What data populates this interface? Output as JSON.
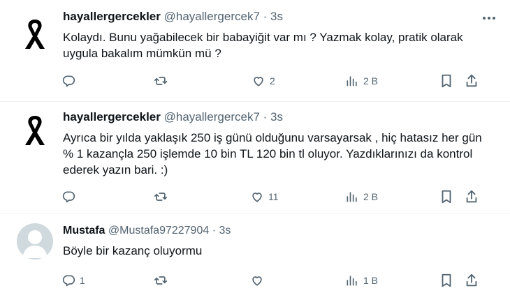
{
  "tweets": [
    {
      "name": "hayallergercekler",
      "handle": "@hayallergercek7",
      "dot": "·",
      "time": "3s",
      "avatar_icon": "black-ribbon-icon",
      "text": "Kolaydı. Bunu yağabilecek bir babayiğit var mı ?  Yazmak kolay, pratik olarak uygula bakalım mümkün mü ?",
      "replies": "",
      "retweets": "",
      "likes": "2",
      "views": "2 B"
    },
    {
      "name": "hayallergercekler",
      "handle": "@hayallergercek7",
      "dot": "·",
      "time": "3s",
      "avatar_icon": "black-ribbon-icon",
      "text": "Ayrıca bir yılda yaklaşık 250 iş günü olduğunu varsayarsak , hiç hatasız her gün % 1 kazançla 250 işlemde 10 bin TL 120 bin tl oluyor. Yazdıklarınızı da kontrol ederek yazın bari. :)",
      "replies": "",
      "retweets": "",
      "likes": "11",
      "views": "2 B"
    },
    {
      "name": "Mustafa",
      "handle": "@Mustafa97227904",
      "dot": "·",
      "time": "3s",
      "avatar_icon": "default-avatar-icon",
      "text": "Böyle bir kazanç oluyormu",
      "replies": "1",
      "retweets": "",
      "likes": "",
      "views": "1 B"
    }
  ],
  "colors": {
    "text": "#0f1419",
    "secondary": "#536471",
    "divider": "#eff3f4",
    "avatar_bg": "#cfd9de"
  }
}
